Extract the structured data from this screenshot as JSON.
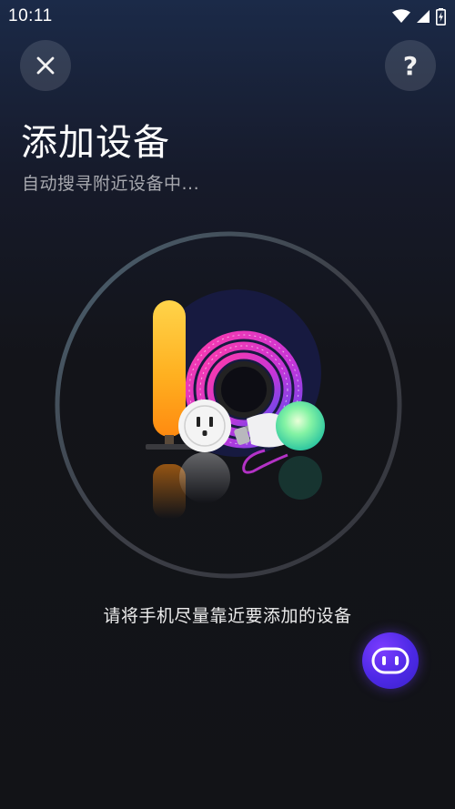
{
  "status_bar": {
    "time": "10:11",
    "icons": [
      "wifi-icon",
      "signal-icon",
      "battery-charging-icon"
    ]
  },
  "header": {
    "close_icon": "close-icon",
    "help_label": "?"
  },
  "title": "添加设备",
  "subtitle": "自动搜寻附近设备中...",
  "illustration": {
    "devices": [
      "light-bar",
      "led-strip-reel",
      "smart-plug",
      "smart-bulb"
    ]
  },
  "hint": "请将手机尽量靠近要添加的设备",
  "assistant": {
    "icon": "robot-assistant-icon"
  },
  "colors": {
    "background": "#131419",
    "accent": "#5a2cf0",
    "ring": "#3a3d45"
  }
}
